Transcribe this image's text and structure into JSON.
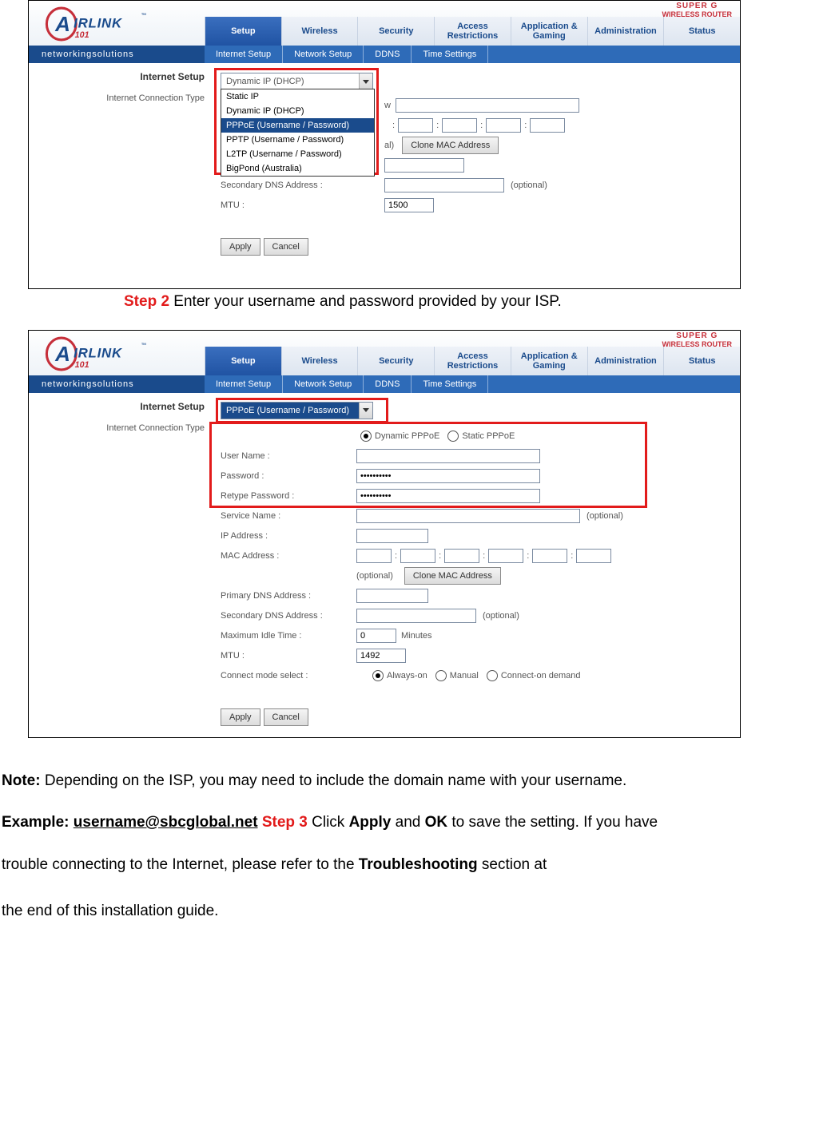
{
  "doc": {
    "step2_label": "Step 2",
    "step2_text": " Enter your username and password provided by your ISP.",
    "note_label": "Note:",
    "note_text": " Depending on the ISP, you may need to include the domain name with your username.",
    "example_label": "Example: ",
    "example_value": "username@sbcglobal.net",
    "step3_label": "Step 3",
    "step3_text_a": " Click ",
    "apply_word": "Apply",
    "and_word": " and ",
    "ok_word": "OK",
    "step3_text_b": " to save the setting. If you have",
    "trouble_line": "trouble connecting to the Internet, please refer to the ",
    "troubleshooting_word": "Troubleshooting",
    "trouble_line_b": " section at",
    "end_line": "the end of this installation guide."
  },
  "router": {
    "brand_tagline": "networkingsolutions",
    "superg_line1": "SUPER G",
    "superg_line2": "WIRELESS ROUTER",
    "nav": [
      "Setup",
      "Wireless",
      "Security",
      "Access Restrictions",
      "Application & Gaming",
      "Administration",
      "Status"
    ],
    "subnav": [
      "Internet Setup",
      "Network Setup",
      "DDNS",
      "Time Settings"
    ],
    "section_title": "Internet Setup",
    "conn_type_label": "Internet Connection Type",
    "buttons": {
      "apply": "Apply",
      "cancel": "Cancel",
      "clone_mac": "Clone MAC Address"
    },
    "optional": "(optional)"
  },
  "shot1": {
    "select_value": "Dynamic IP (DHCP)",
    "dropdown_options": [
      {
        "text": "Static IP",
        "sel": false
      },
      {
        "text": "Dynamic IP (DHCP)",
        "sel": false
      },
      {
        "text": "PPPoE (Username / Password)",
        "sel": true
      },
      {
        "text": "PPTP (Username / Password)",
        "sel": false
      },
      {
        "text": "L2TP (Username / Password)",
        "sel": false
      },
      {
        "text": "BigPond (Australia)",
        "sel": false
      }
    ],
    "fields": {
      "host_suffix": "w",
      "mac_suffix": "al)",
      "sec_dns": "Secondary DNS Address :",
      "mtu_label": "MTU :",
      "mtu_value": "1500"
    }
  },
  "shot2": {
    "select_value": "PPPoE (Username / Password)",
    "radio": {
      "dyn": "Dynamic PPPoE",
      "stat": "Static PPPoE"
    },
    "fields": {
      "username": "User Name :",
      "password": "Password :",
      "retype": "Retype Password :",
      "service": "Service Name :",
      "ip": "IP Address :",
      "mac": "MAC Address :",
      "pdns": "Primary DNS Address :",
      "sdns": "Secondary DNS Address :",
      "idle": "Maximum Idle Time :",
      "idle_val": "0",
      "idle_unit": "Minutes",
      "mtu": "MTU :",
      "mtu_value": "1492",
      "connect": "Connect mode select :",
      "pw_mask": "••••••••••"
    },
    "connect_modes": {
      "always": "Always-on",
      "manual": "Manual",
      "demand": "Connect-on demand"
    }
  }
}
